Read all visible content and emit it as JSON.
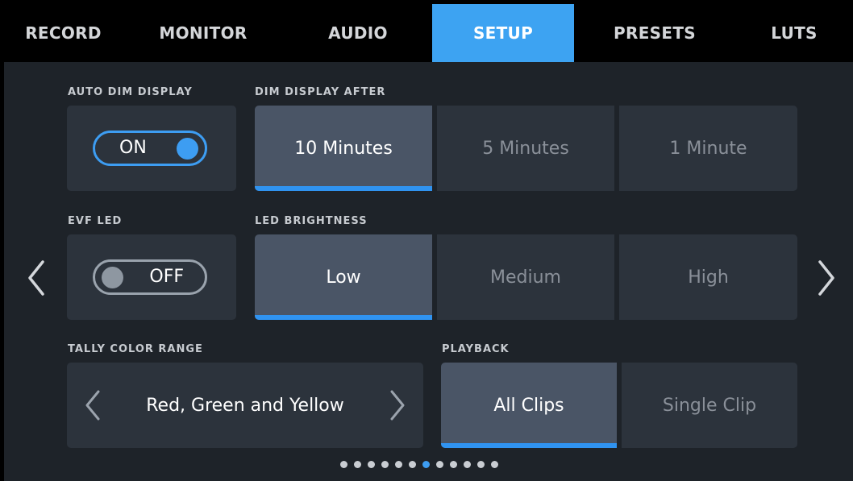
{
  "tabs": [
    {
      "label": "RECORD",
      "active": false
    },
    {
      "label": "MONITOR",
      "active": false
    },
    {
      "label": "AUDIO",
      "active": false
    },
    {
      "label": "SETUP",
      "active": true
    },
    {
      "label": "PRESETS",
      "active": false
    },
    {
      "label": "LUTS",
      "active": false
    }
  ],
  "auto_dim": {
    "label": "AUTO DIM DISPLAY",
    "toggle_text": "ON",
    "state": "on"
  },
  "dim_after": {
    "label": "DIM DISPLAY AFTER",
    "options": [
      "10 Minutes",
      "5 Minutes",
      "1 Minute"
    ],
    "selected": "10 Minutes"
  },
  "evf_led": {
    "label": "EVF LED",
    "toggle_text": "OFF",
    "state": "off"
  },
  "led_brightness": {
    "label": "LED BRIGHTNESS",
    "options": [
      "Low",
      "Medium",
      "High"
    ],
    "selected": "Low"
  },
  "tally": {
    "label": "TALLY COLOR RANGE",
    "value": "Red, Green and Yellow"
  },
  "playback": {
    "label": "PLAYBACK",
    "options": [
      "All Clips",
      "Single Clip"
    ],
    "selected": "All Clips"
  },
  "pagination": {
    "total": 12,
    "current": 7
  },
  "colors": {
    "accent": "#3da3f2",
    "background": "#1e2329",
    "card": "#2c333c",
    "selected": "#4a5566"
  }
}
